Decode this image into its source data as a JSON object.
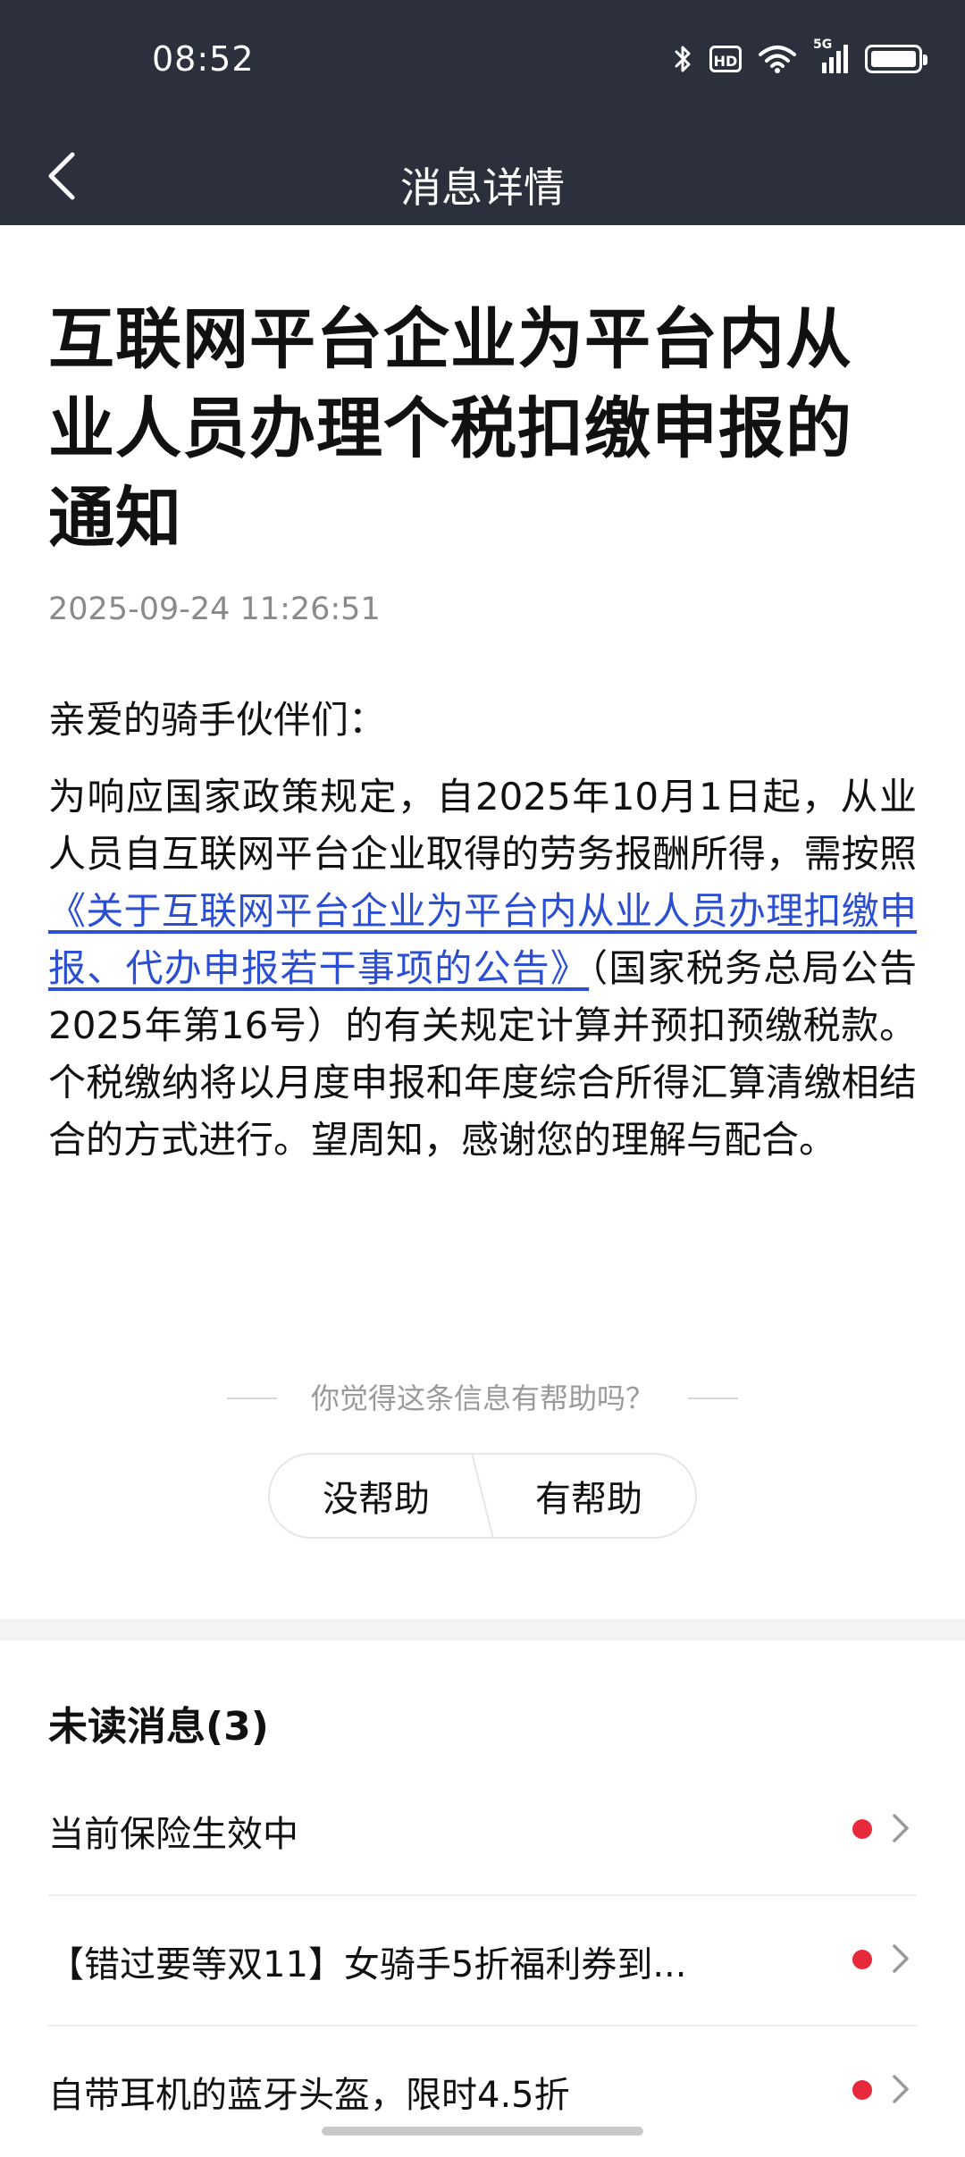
{
  "status": {
    "time": "08:52",
    "hd_label": "HD",
    "network_label": "5G",
    "icons": [
      "bluetooth-icon",
      "hd-icon",
      "wifi-icon",
      "signal-icon",
      "battery-icon"
    ]
  },
  "nav": {
    "title": "消息详情",
    "back_icon": "chevron-left-icon"
  },
  "article": {
    "title": "互联网平台企业为平台内从业人员办理个税扣缴申报的通知",
    "date": "2025-09-24 11:26:51",
    "greeting": "亲爱的骑手伙伴们：",
    "body_before": "为响应国家政策规定，自2025年10月1日起，从业人员自互联网平台企业取得的劳务报酬所得，需按照",
    "link_text": "《关于互联网平台企业为平台内从业人员办理扣缴申报、代办申报若干事项的公告》",
    "body_after": "（国家税务总局公告2025年第16号）的有关规定计算并预扣预缴税款。个税缴纳将以月度申报和年度综合所得汇算清缴相结合的方式进行。望周知，感谢您的理解与配合。"
  },
  "feedback": {
    "question": "你觉得这条信息有帮助吗？",
    "not_helpful": "没帮助",
    "helpful": "有帮助"
  },
  "unread": {
    "title": "未读消息(3)",
    "items": [
      {
        "text": "当前保险生效中"
      },
      {
        "text": "【错过要等双11】女骑手5折福利券到..."
      },
      {
        "text": "自带耳机的蓝牙头盔，限时4.5折"
      }
    ]
  },
  "colors": {
    "header_bg": "#2b303c",
    "link": "#2c4fd1",
    "unread_dot": "#e8293b",
    "separator": "#f3f3f3"
  }
}
